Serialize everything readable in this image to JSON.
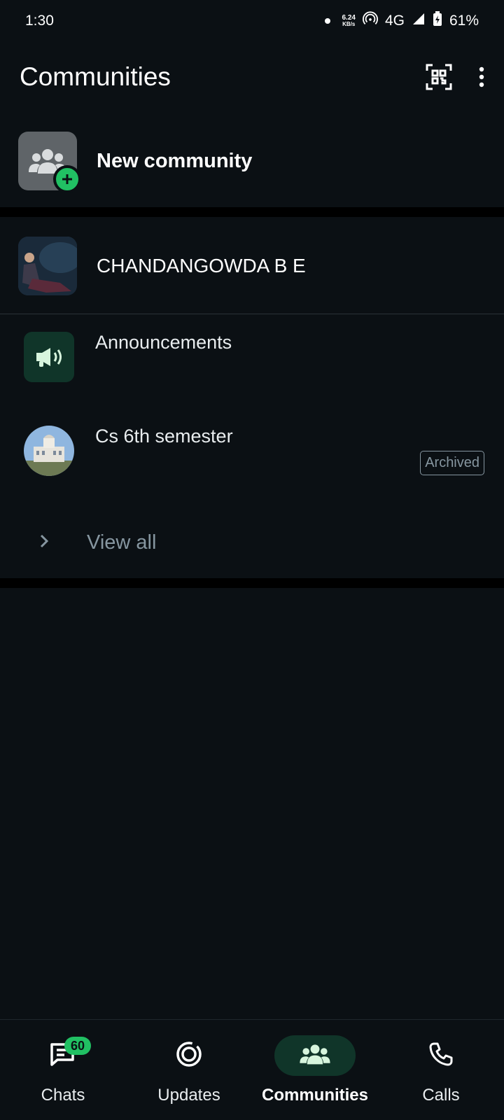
{
  "status_bar": {
    "time": "1:30",
    "net_speed_value": "6.24",
    "net_speed_unit": "KB/s",
    "network": "4G",
    "battery": "61%"
  },
  "header": {
    "title": "Communities",
    "qr_icon": "qr-scanner-icon",
    "menu_icon": "more-vertical-icon"
  },
  "new_community": {
    "label": "New community",
    "icon": "community-add-icon"
  },
  "community": {
    "name": "CHANDANGOWDA B E",
    "groups": [
      {
        "name": "Announcements",
        "icon": "megaphone-icon",
        "tag": ""
      },
      {
        "name": "Cs 6th semester",
        "icon": "group-photo",
        "tag": "Archived"
      }
    ],
    "view_all": "View all"
  },
  "bottom_nav": {
    "items": [
      {
        "label": "Chats",
        "icon": "chats-icon",
        "badge": "60",
        "active": false
      },
      {
        "label": "Updates",
        "icon": "updates-icon",
        "active": false
      },
      {
        "label": "Communities",
        "icon": "communities-icon",
        "active": true
      },
      {
        "label": "Calls",
        "icon": "phone-icon",
        "active": false
      }
    ]
  },
  "colors": {
    "background": "#0b1014",
    "accent": "#21c063",
    "active_pill": "#103529",
    "muted_text": "#8696a0"
  }
}
